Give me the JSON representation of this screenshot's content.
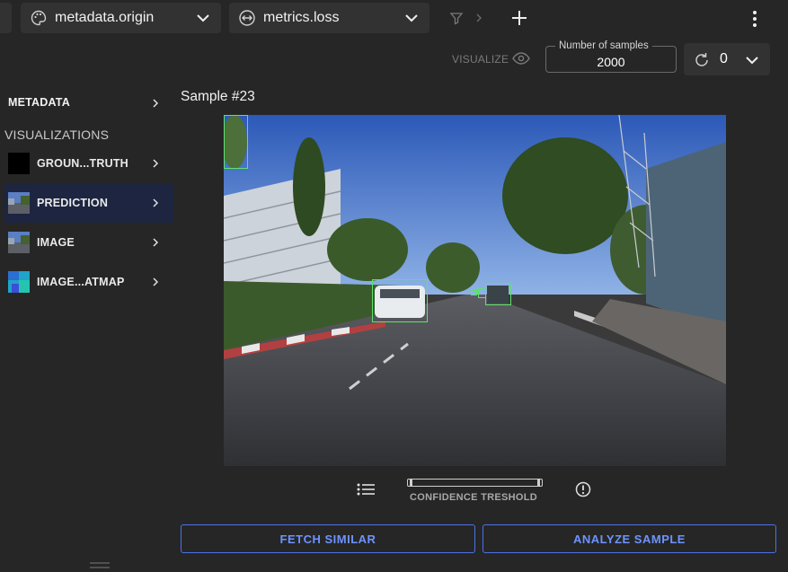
{
  "toolbar": {
    "selector1": {
      "label": "metadata.origin",
      "icon": "palette-icon"
    },
    "selector2": {
      "label": "metrics.loss",
      "icon": "horizontal-arrows-icon"
    },
    "filter_icon": "filter-icon",
    "add_icon": "plus-icon",
    "more_icon": "more-vertical-icon"
  },
  "controls_row": {
    "visualize_label": "VISUALIZE",
    "samples_legend": "Number of samples",
    "samples_value": "2000",
    "counter_value": "0"
  },
  "sidebar": {
    "metadata_label": "METADATA",
    "visualizations_label": "VISUALIZATIONS",
    "items": [
      {
        "label": "GROUN...TRUTH",
        "thumb": "black-square"
      },
      {
        "label": "PREDICTION",
        "thumb": "street-thumbnail",
        "active": true
      },
      {
        "label": "IMAGE",
        "thumb": "street-thumbnail"
      },
      {
        "label": "IMAGE...ATMAP",
        "thumb": "heatmap-thumbnail"
      }
    ]
  },
  "sample": {
    "title": "Sample #23"
  },
  "bottom_controls": {
    "confidence_label": "CONFIDENCE TRESHOLD"
  },
  "actions": {
    "fetch_label": "FETCH SIMILAR",
    "analyze_label": "ANALYZE SAMPLE"
  },
  "colors": {
    "accent": "#4a73e8",
    "bbox": "#5ee26b",
    "background": "#262626"
  }
}
